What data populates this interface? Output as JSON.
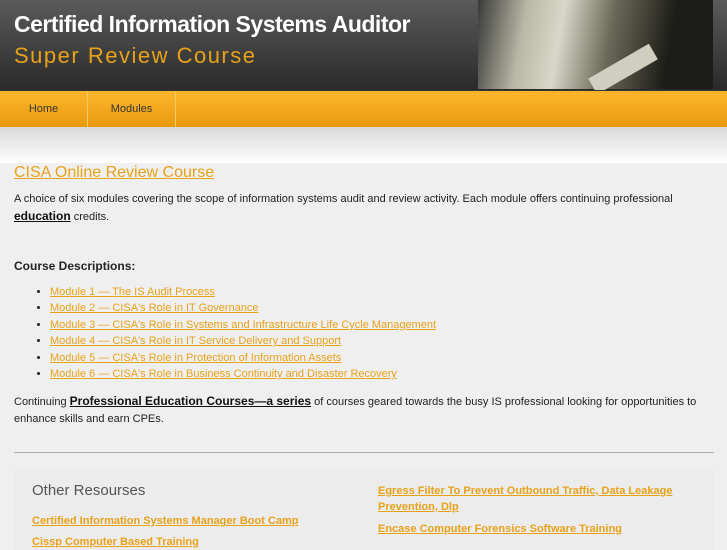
{
  "header": {
    "title": "Certified Information Systems Auditor",
    "subtitle": "Super Review Course"
  },
  "nav": [
    {
      "label": "Home"
    },
    {
      "label": "Modules"
    }
  ],
  "main": {
    "heading": "CISA Online Review Course",
    "intro_text": "A choice of six modules covering the scope of information systems audit and review activity. Each module offers continuing professional",
    "intro_link": "education",
    "intro_tail": " credits.",
    "course_heading": "Course Descriptions:",
    "modules": [
      "Module 1 — The IS Audit Process",
      "Module 2 — CISA's Role in IT Governance",
      "Module 3 — CISA's Role in Systems and Infrastructure Life Cycle Management",
      "Module 4 — CISA's Role in IT Service Delivery and Support",
      "Module 5 — CISA's Role in Protection of Information Assets",
      "Module 6 — CISA's Role in Business Continuity and Disaster Recovery"
    ],
    "cont_pre": "Continuing ",
    "cont_link": "Professional Education Courses—a series",
    "cont_post": " of courses geared towards the busy IS professional looking for opportunities to enhance skills and earn CPEs."
  },
  "resources": {
    "heading": "Other Resourses",
    "left": [
      "Certified Information Systems Manager Boot Camp",
      "Cissp Computer Based Training"
    ],
    "right": [
      "Egress Filter To Prevent Outbound Traffic, Data Leakage Prevention, Dlp",
      "Encase Computer Forensics Software Training"
    ]
  }
}
